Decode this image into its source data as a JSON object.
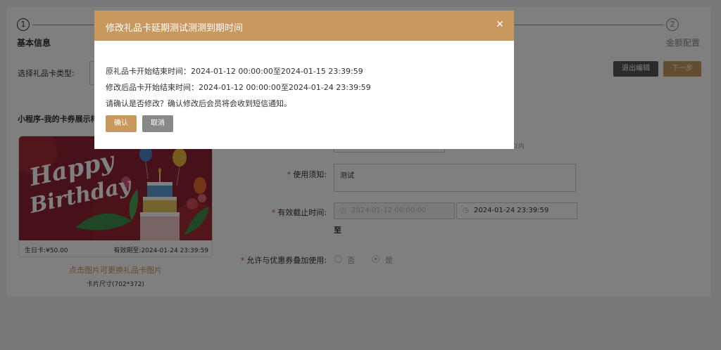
{
  "steps": [
    {
      "number": "1",
      "label": "基本信息"
    },
    {
      "number": "2",
      "label": "金额配置"
    }
  ],
  "form": {
    "card_type_label": "选择礼品卡类型:",
    "preview_label": "小程序-我的卡券展示样",
    "usage_label": "使用须知:",
    "usage_value": "测试",
    "valid_label": "有效截止时间:",
    "valid_start": "2024-01-12 00:00:00",
    "valid_end": "2024-01-24 23:39:59",
    "range_separator": "至",
    "stack_label": "允许与优惠券叠加使用:",
    "stack_options": [
      "否",
      "是"
    ],
    "stack_selected": "是",
    "hint_fragment": "字以内"
  },
  "toolbar": {
    "exit_label": "退出编辑",
    "next_label": "下一步"
  },
  "card": {
    "art_text_line1": "Happy",
    "art_text_line2": "Birthday",
    "name_price": "生日卡:¥50.00",
    "expiry": "有效期至:2024-01-24 23:39:59",
    "change_image_link": "点击图片可更换礼品卡图片",
    "size_note": "卡片尺寸(702*372)"
  },
  "modal": {
    "title": "修改礼品卡延期测试测测到期时间",
    "original_line": "原礼品卡开始结束时间：2024-01-12 00:00:00至2024-01-15 23:39:59",
    "modified_line": "修改后品卡开始结束时间：2024-01-12 00:00:00至2024-01-24 23:39:59",
    "confirm_prompt": "请确认是否修改？确认修改后会员将会收到短信通知。",
    "confirm_label": "确认",
    "cancel_label": "取消",
    "close_icon": "close-icon"
  },
  "colors": {
    "accent": "#c9985f",
    "overlay": "rgba(0,0,0,0.5)",
    "required": "#e53935",
    "card_bg": "#8c2230"
  }
}
